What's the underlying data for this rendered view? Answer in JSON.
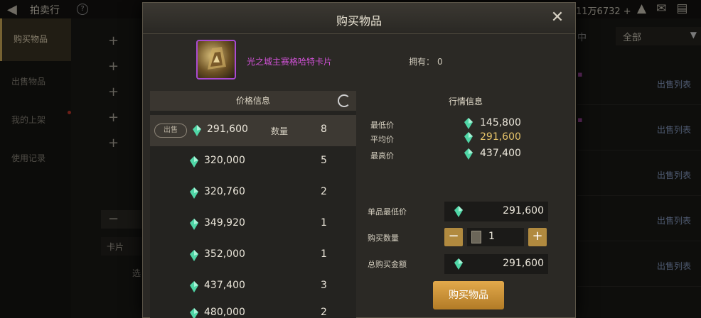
{
  "topbar": {
    "title": "拍卖行",
    "help": "?",
    "currency_text": "11万6732 +"
  },
  "sidebar": {
    "items": [
      {
        "label": "购买物品",
        "active": true
      },
      {
        "label": "出售物品",
        "active": false
      },
      {
        "label": "我的上架",
        "active": false
      },
      {
        "label": "使用记录",
        "active": false
      }
    ]
  },
  "background": {
    "plus_buttons": [
      "+",
      "+",
      "+",
      "+",
      "+"
    ],
    "minus": "−",
    "card_label": "卡片",
    "cut_button": "选",
    "filter_value": "全部",
    "header_fragment": "中",
    "list_buttons": [
      "出售列表",
      "出售列表",
      "出售列表",
      "出售列表",
      "出售列表"
    ]
  },
  "modal": {
    "title": "购买物品",
    "close": "✕",
    "item_name": "光之城主赛格哈特卡片",
    "owned_label": "拥有：",
    "owned_count": "0",
    "price_panel": {
      "header": "价格信息",
      "sell_label": "出售",
      "qty_label": "数量",
      "rows": [
        {
          "price": "291,600",
          "qty": "8"
        },
        {
          "price": "320,000",
          "qty": "5"
        },
        {
          "price": "320,760",
          "qty": "2"
        },
        {
          "price": "349,920",
          "qty": "1"
        },
        {
          "price": "352,000",
          "qty": "1"
        },
        {
          "price": "437,400",
          "qty": "3"
        },
        {
          "price": "480,000",
          "qty": "2"
        }
      ]
    },
    "market": {
      "header": "行情信息",
      "min_label": "最低价",
      "min_value": "145,800",
      "avg_label": "平均价",
      "avg_value": "291,600",
      "max_label": "最高价",
      "max_value": "437,400"
    },
    "unit_price_label": "单品最低价",
    "unit_price_value": "291,600",
    "buy_qty_label": "购买数量",
    "buy_qty_value": "1",
    "minus": "−",
    "plus": "+",
    "total_label": "总购买金额",
    "total_value": "291,600",
    "buy_button": "购买物品"
  },
  "colors": {
    "accent_gold": "#b18a3f",
    "item_name": "#d252d8",
    "gem": "#4fd6a6"
  }
}
